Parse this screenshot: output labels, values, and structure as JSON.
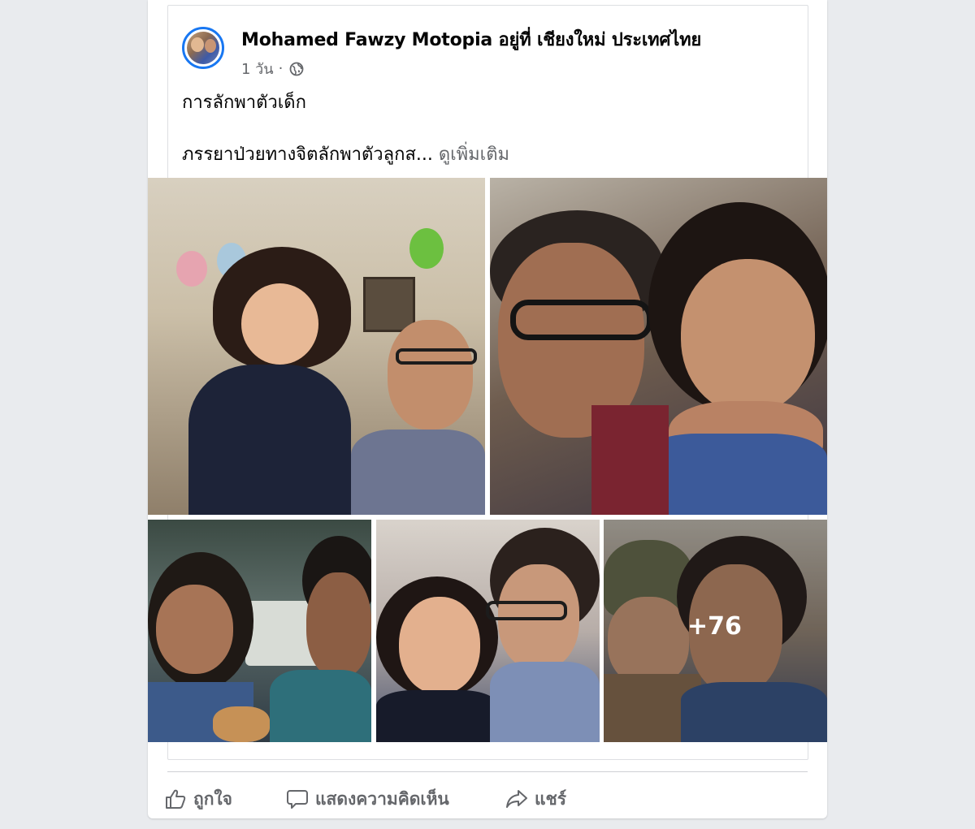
{
  "post": {
    "author": "Mohamed Fawzy Motopia อยู่ที่ เชียงใหม่ ประเทศไทย",
    "time": "1 วัน",
    "separator": "·",
    "privacy_icon": "globe-icon",
    "text_line1": "การลักพาตัวเด็ก",
    "text_line2": "ภรรยาป่วยทางจิตลักพาตัวลูกส...",
    "see_more": "ดูเพิ่มเติม",
    "more_photos": "+76"
  },
  "actions": {
    "like_label": "ถูกใจ",
    "like_icon": "thumbs-up-icon",
    "comment_label": "แสดงความคิดเห็น",
    "comment_icon": "speech-bubble-icon",
    "share_label": "แชร์",
    "share_icon": "share-arrow-icon"
  },
  "colors": {
    "background": "#e9ebee",
    "card": "#ffffff",
    "text": "#050505",
    "muted": "#65676b",
    "accent": "#1877f2"
  }
}
